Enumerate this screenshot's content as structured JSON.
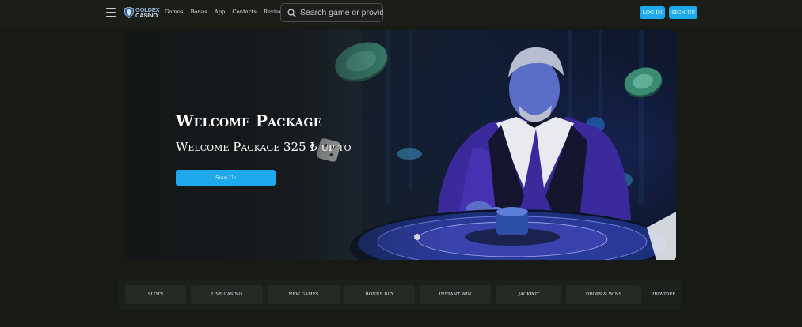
{
  "header": {
    "logo_line1": "GOLDEX",
    "logo_line2": "CASINO",
    "nav": [
      "Games",
      "Bonus",
      "App",
      "Contacts",
      "Reviews"
    ],
    "search_placeholder": "Search game or provider",
    "login_label": "LOG IN",
    "signup_label": "SIGN UP"
  },
  "hero": {
    "title": "Welcome Package",
    "subtitle": "Welcome Package 325 ₺ up to",
    "button_label": "Sign Up"
  },
  "tabs": [
    "Slots",
    "Live casino",
    "New games",
    "Bonus buy",
    "Instant win",
    "Jackpot",
    "Drops & wins",
    "Provider"
  ],
  "colors": {
    "accent": "#1ea9ec",
    "background": "#171a15"
  },
  "icons": {
    "menu": "hamburger-icon",
    "search": "search-icon",
    "logo": "shield-logo-icon"
  }
}
